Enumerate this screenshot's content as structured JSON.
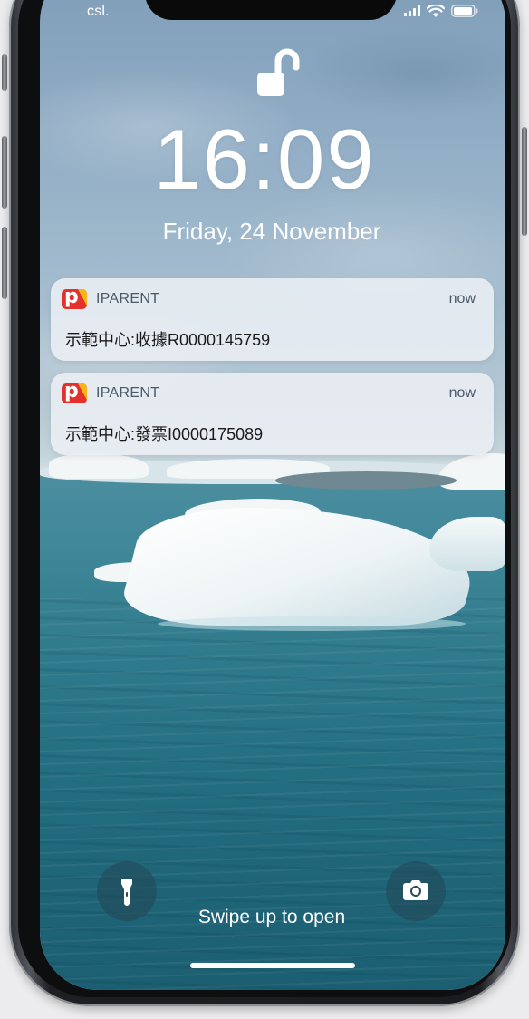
{
  "status_bar": {
    "carrier": "csl.",
    "signal_icon": "cellular-signal-icon",
    "wifi_icon": "wifi-icon",
    "battery_icon": "battery-icon"
  },
  "lock_screen": {
    "lock_icon": "unlocked-padlock-icon",
    "time": "16:09",
    "date": "Friday, 24 November"
  },
  "notifications": [
    {
      "app_name": "IPARENT",
      "app_icon": "iparent-app-icon",
      "time": "now",
      "body": "示範中心:收據R0000145759"
    },
    {
      "app_name": "IPARENT",
      "app_icon": "iparent-app-icon",
      "time": "now",
      "body": "示範中心:發票I0000175089"
    }
  ],
  "bottom": {
    "flashlight_icon": "flashlight-icon",
    "camera_icon": "camera-icon",
    "swipe_hint": "Swipe up to open"
  },
  "colors": {
    "app_icon_red": "#e4312b",
    "app_icon_yellow": "#f6b51b",
    "notification_bg": "#ecf0f4"
  }
}
